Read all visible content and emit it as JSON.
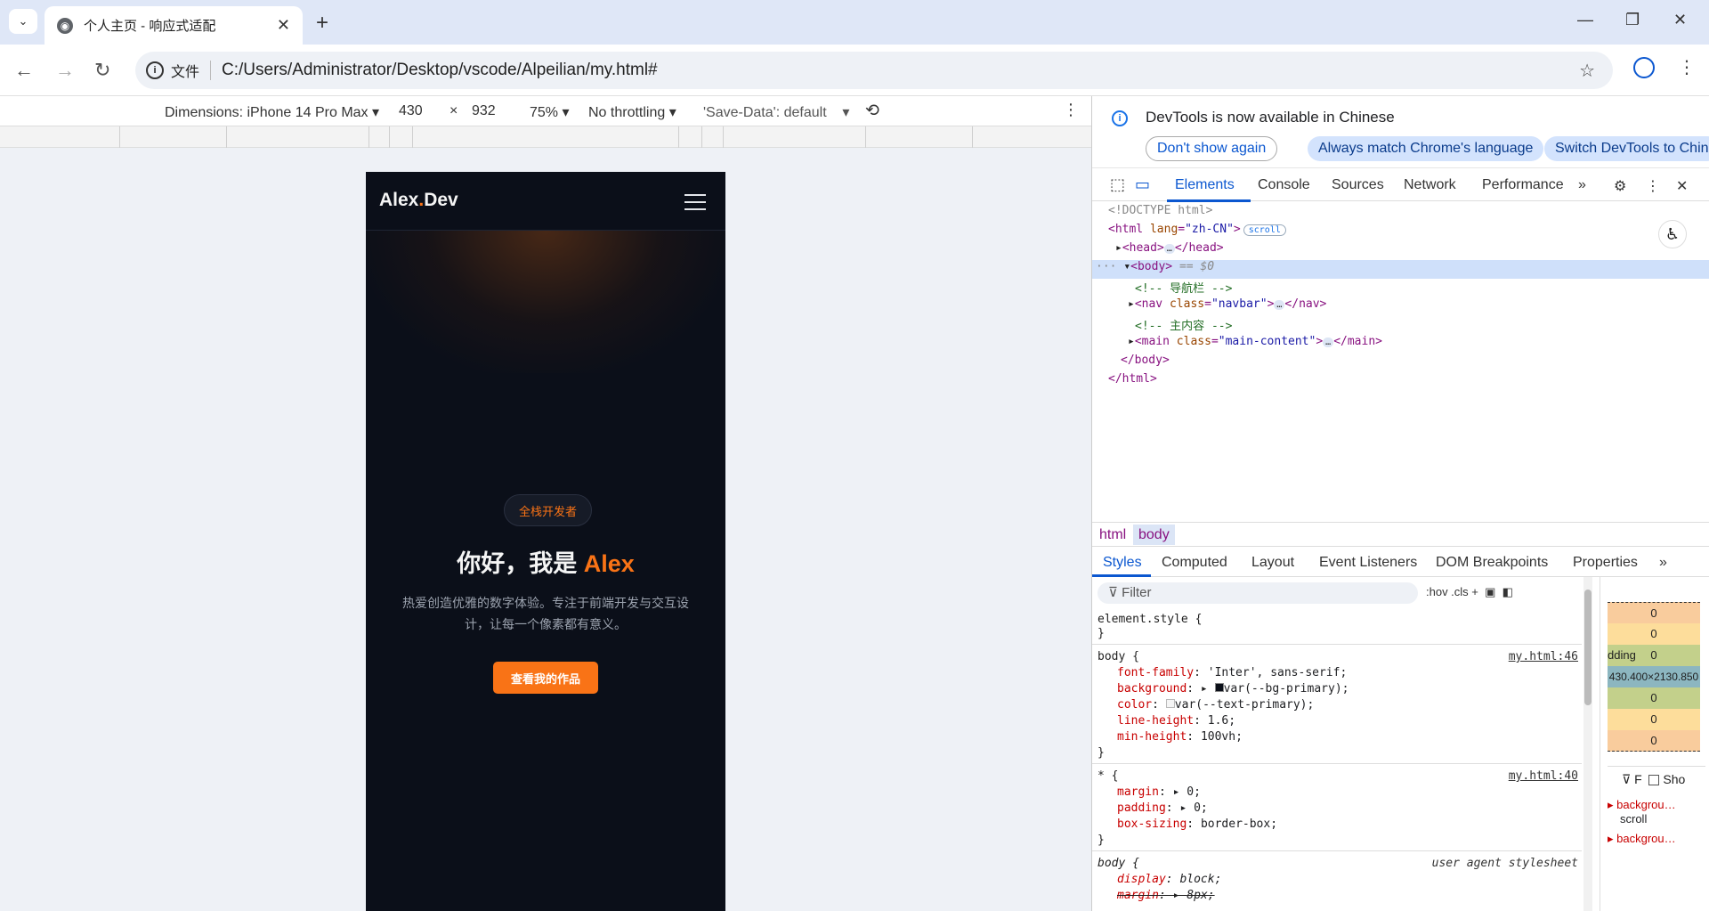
{
  "browser": {
    "tab_title": "个人主页 - 响应式适配",
    "url_chip": "文件",
    "url": "C:/Users/Administrator/Desktop/vscode/Alpeilian/my.html#"
  },
  "device_toolbar": {
    "dimensions": "Dimensions: iPhone 14 Pro Max",
    "width": "430",
    "times": "×",
    "height": "932",
    "zoom": "75%",
    "throttling": "No throttling",
    "save_data": "'Save-Data': default"
  },
  "page": {
    "logo_main": "Alex",
    "logo_dot": ".",
    "logo_suffix": "Dev",
    "badge": "全栈开发者",
    "title_prefix": "你好，我是 ",
    "title_accent": "Alex",
    "description": "热爱创造优雅的数字体验。专注于前端开发与交互设计，让每一个像素都有意义。",
    "cta": "查看我的作品",
    "colors": {
      "bg": "#0b0f19",
      "accent": "#f97316"
    }
  },
  "devtools": {
    "notice_title": "DevTools is now available in Chinese",
    "btn_dont_show": "Don't show again",
    "btn_match": "Always match Chrome's language",
    "btn_switch": "Switch DevTools to Chin",
    "tabs": [
      "Elements",
      "Console",
      "Sources",
      "Network",
      "Performance"
    ],
    "dom": {
      "doctype": "<!DOCTYPE html>",
      "html_open": "<html",
      "lang_attr": "lang",
      "lang_val": "\"zh-CN\"",
      "scroll_pill": "scroll",
      "head": "<head>",
      "head_close": "</head>",
      "body": "<body>",
      "body_eq": "== $0",
      "comment_nav": "<!-- 导航栏 -->",
      "nav_open": "<nav",
      "class_attr": "class",
      "nav_class": "\"navbar\"",
      "nav_close": "</nav>",
      "comment_main": "<!-- 主内容 -->",
      "main_open": "<main",
      "main_class": "\"main-content\"",
      "main_close": "</main>",
      "body_close": "</body>",
      "html_close": "</html>",
      "ellipsis": "…"
    },
    "breadcrumbs": [
      "html",
      "body"
    ],
    "subtabs": [
      "Styles",
      "Computed",
      "Layout",
      "Event Listeners",
      "DOM Breakpoints",
      "Properties"
    ],
    "filter_placeholder": "Filter",
    "filter_tools": ":hov  .cls  +",
    "styles": {
      "element_style": "element.style {",
      "close": "}",
      "body_sel": "body {",
      "body_src": "my.html:46",
      "font_family": "font-family",
      "font_family_val": "'Inter', sans-serif;",
      "background": "background",
      "background_val": "var(--bg-primary);",
      "color": "color",
      "color_val": "var(--text-primary);",
      "line_height": "line-height",
      "line_height_val": "1.6;",
      "min_height": "min-height",
      "min_height_val": "100vh;",
      "star_sel": "* {",
      "star_src": "my.html:40",
      "margin": "margin",
      "margin_val": "▸ 0;",
      "padding": "padding",
      "padding_val": "▸ 0;",
      "box_sizing": "box-sizing",
      "box_sizing_val": "border-box;",
      "ua_sel": "body {",
      "ua_src": "user agent stylesheet",
      "display": "display",
      "display_val": "block;",
      "ua_margin": "margin",
      "ua_margin_val": "8px;"
    },
    "boxmodel": {
      "values": [
        "0",
        "0",
        "0",
        "0",
        "0",
        "0"
      ],
      "padding_label": "dding",
      "content": "430.400×2130.850",
      "show_label": "Sho",
      "bg_label": "backgrou…",
      "scroll_val": "scroll",
      "bg_label2": "backgrou…"
    }
  }
}
